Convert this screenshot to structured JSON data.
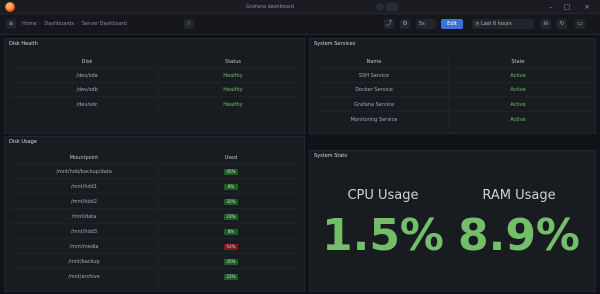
{
  "window": {
    "title": "Grafana dashboard",
    "minimize_glyph": "–",
    "maximize_glyph": "□",
    "close_glyph": "×"
  },
  "toolbar": {
    "breadcrumbs": [
      "Home",
      "Dashboards",
      "Server Dashboard"
    ],
    "time_range": "Last 6 hours",
    "refresh_label": "5s",
    "primary_label": "Edit",
    "icons": [
      "menu-icon",
      "star-icon",
      "share-icon",
      "settings-icon",
      "clock-icon",
      "zoom-out-icon",
      "refresh-icon",
      "tv-icon"
    ]
  },
  "panels": {
    "disk_health": {
      "title": "Disk Health",
      "columns": [
        "Disk",
        "Status"
      ],
      "rows": [
        {
          "disk": "/dev/sda",
          "status": "Healthy"
        },
        {
          "disk": "/dev/sdb",
          "status": "Healthy"
        },
        {
          "disk": "/dev/sdc",
          "status": "Healthy"
        }
      ]
    },
    "system_services": {
      "title": "System Services",
      "columns": [
        "Name",
        "State"
      ],
      "rows": [
        {
          "name": "SSH Service",
          "state": "Active"
        },
        {
          "name": "Docker Service",
          "state": "Active"
        },
        {
          "name": "Grafana Service",
          "state": "Active"
        },
        {
          "name": "Monitoring Service",
          "state": "Active"
        }
      ]
    },
    "disk_usage": {
      "title": "Disk Usage",
      "columns": [
        "Mountpoint",
        "Used"
      ],
      "rows": [
        {
          "mount": "/mnt/hdd/backup/data",
          "used": "45%",
          "level": "ok"
        },
        {
          "mount": "/mnt/hdd1",
          "used": "8%",
          "level": "ok"
        },
        {
          "mount": "/mnt/hdd2",
          "used": "32%",
          "level": "ok"
        },
        {
          "mount": "/mnt/data",
          "used": "23%",
          "level": "ok"
        },
        {
          "mount": "/mnt/hdd3",
          "used": "8%",
          "level": "ok"
        },
        {
          "mount": "/mnt/media",
          "used": "92%",
          "level": "critical"
        },
        {
          "mount": "/mnt/backup",
          "used": "35%",
          "level": "ok"
        },
        {
          "mount": "/mnt/archive",
          "used": "22%",
          "level": "ok"
        }
      ]
    },
    "system_stats": {
      "title": "System Stats",
      "cpu_label": "CPU Usage",
      "cpu_value": "1.5%",
      "ram_label": "RAM Usage",
      "ram_value": "8.9%"
    }
  },
  "colors": {
    "ok": "#73bf69",
    "critical": "#7a1e1e",
    "primary": "#3d71d9",
    "background": "#111217",
    "panel": "#181b1f"
  }
}
